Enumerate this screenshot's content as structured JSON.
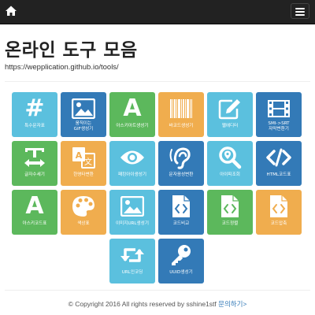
{
  "nav": {
    "home_icon": "home-icon",
    "menu_icon": "hamburger-menu-icon"
  },
  "header": {
    "title": "온라인 도구 모음",
    "url": "https://wepplication.github.io/tools/"
  },
  "colors": {
    "navbar": "#222222",
    "info": "#5bc0de",
    "primary": "#337ab7",
    "success": "#5cb85c",
    "warning": "#f0ad4e",
    "link": "#337ab7"
  },
  "tools": [
    {
      "label": "특수문자표",
      "icon": "hash-icon",
      "color": "#5bc0de"
    },
    {
      "label": "움직이는\nGIF생성기",
      "icon": "image-icon",
      "color": "#337ab7"
    },
    {
      "label": "아스키아트생성기",
      "icon": "letter-a-icon",
      "color": "#5cb85c"
    },
    {
      "label": "바코드생성기",
      "icon": "barcode-icon",
      "color": "#f0ad4e"
    },
    {
      "label": "웹에디터",
      "icon": "edit-icon",
      "color": "#5bc0de"
    },
    {
      "label": "SMI->SRT\n자막변환기",
      "icon": "film-icon",
      "color": "#337ab7"
    },
    {
      "label": "글자수세기",
      "icon": "text-width-icon",
      "color": "#5cb85c"
    },
    {
      "label": "한영타변환",
      "icon": "translate-icon",
      "color": "#f0ad4e"
    },
    {
      "label": "패킹아이생성기",
      "icon": "eye-icon",
      "color": "#5bc0de"
    },
    {
      "label": "문자음성변환",
      "icon": "hearing-icon",
      "color": "#337ab7"
    },
    {
      "label": "아이피조회",
      "icon": "search-location-icon",
      "color": "#5bc0de"
    },
    {
      "label": "HTML코드표",
      "icon": "code-icon",
      "color": "#337ab7"
    },
    {
      "label": "아스키코드표",
      "icon": "letter-a-icon",
      "color": "#5cb85c"
    },
    {
      "label": "색상표",
      "icon": "palette-icon",
      "color": "#f0ad4e"
    },
    {
      "label": "이미지URL생성기",
      "icon": "image-icon",
      "color": "#5bc0de"
    },
    {
      "label": "코드비교",
      "icon": "code-file-icon",
      "color": "#337ab7"
    },
    {
      "label": "코드정렬",
      "icon": "code-file-icon",
      "color": "#5cb85c"
    },
    {
      "label": "코드압축",
      "icon": "code-file-icon",
      "color": "#f0ad4e"
    },
    {
      "label": "URL인코딩",
      "icon": "retweet-icon",
      "color": "#5bc0de"
    },
    {
      "label": "UUID생성기",
      "icon": "key-icon",
      "color": "#337ab7"
    }
  ],
  "footer": {
    "copyright": "© Copyright 2016 All rights reserved by sshine1stf",
    "contact_link": "문의하기>"
  }
}
